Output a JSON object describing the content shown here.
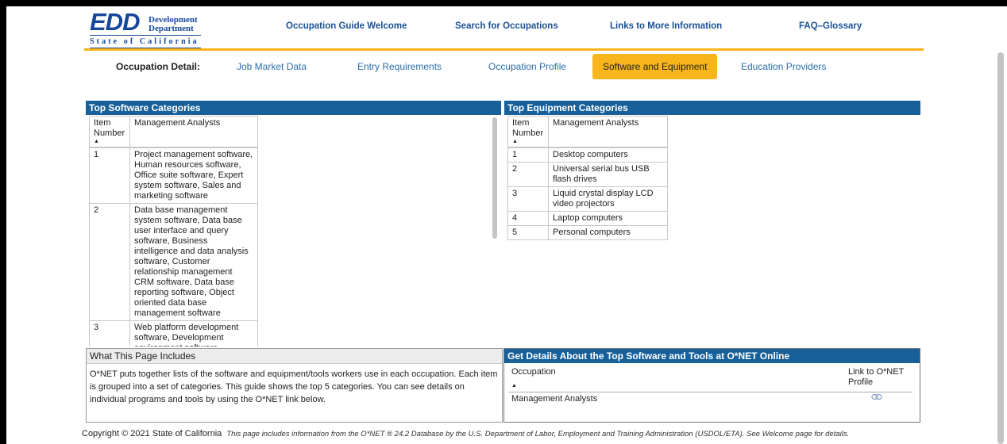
{
  "logo": {
    "edd": "EDD",
    "development": "Development",
    "department": "Department",
    "state": "State of California"
  },
  "topnav": [
    "Occupation Guide Welcome",
    "Search for Occupations",
    "Links to More Information",
    "FAQ–Glossary"
  ],
  "subnav": {
    "label": "Occupation Detail:",
    "tabs": [
      "Job Market Data",
      "Entry Requirements",
      "Occupation Profile",
      "Software and Equipment",
      "Education Providers"
    ],
    "active": "Software and Equipment"
  },
  "software": {
    "title": "Top Software Categories",
    "col_item": "Item Number",
    "col_occ": "Management Analysts",
    "rows": [
      {
        "num": "1",
        "text": "Project management software, Human resources software, Office suite software, Expert system software, Sales and marketing software"
      },
      {
        "num": "2",
        "text": "Data base management system software, Data base user interface and query software, Business intelligence and data analysis software, Customer relationship management CRM software, Data base reporting software, Object oriented data base management software"
      },
      {
        "num": "3",
        "text": "Web platform development software, Development environment software"
      }
    ]
  },
  "equipment": {
    "title": "Top Equipment Categories",
    "col_item": "Item Number",
    "col_occ": "Management Analysts",
    "rows": [
      {
        "num": "1",
        "text": "Desktop computers"
      },
      {
        "num": "2",
        "text": "Universal serial bus USB flash drives"
      },
      {
        "num": "3",
        "text": "Liquid crystal display LCD video projectors"
      },
      {
        "num": "4",
        "text": "Laptop computers"
      },
      {
        "num": "5",
        "text": "Personal computers"
      }
    ]
  },
  "includes": {
    "title": "What This Page Includes",
    "body": "O*NET puts together lists of the software and equipment/tools workers use in each occupation. Each item is grouped into a set of categories. This guide shows the top 5 categories. You can see details on individual programs and tools by using the O*NET link below."
  },
  "onet": {
    "title": "Get Details About the Top Software and Tools at O*NET Online",
    "col_occ": "Occupation",
    "col_link": "Link to O*NET Profile",
    "occupation": "Management Analysts",
    "link_icon": "link-icon"
  },
  "footer": {
    "copyright": "Copyright © 2021 State of California",
    "note": "This page includes information from the O*NET ® 24.2 Database by the U.S. Department of Labor, Employment and Training Administration (USDOL/ETA). See Welcome page for details."
  },
  "colors": {
    "bar_blue": "#17609a",
    "accent_gold": "#f8b51c",
    "nav_blue": "#1a4f94"
  }
}
